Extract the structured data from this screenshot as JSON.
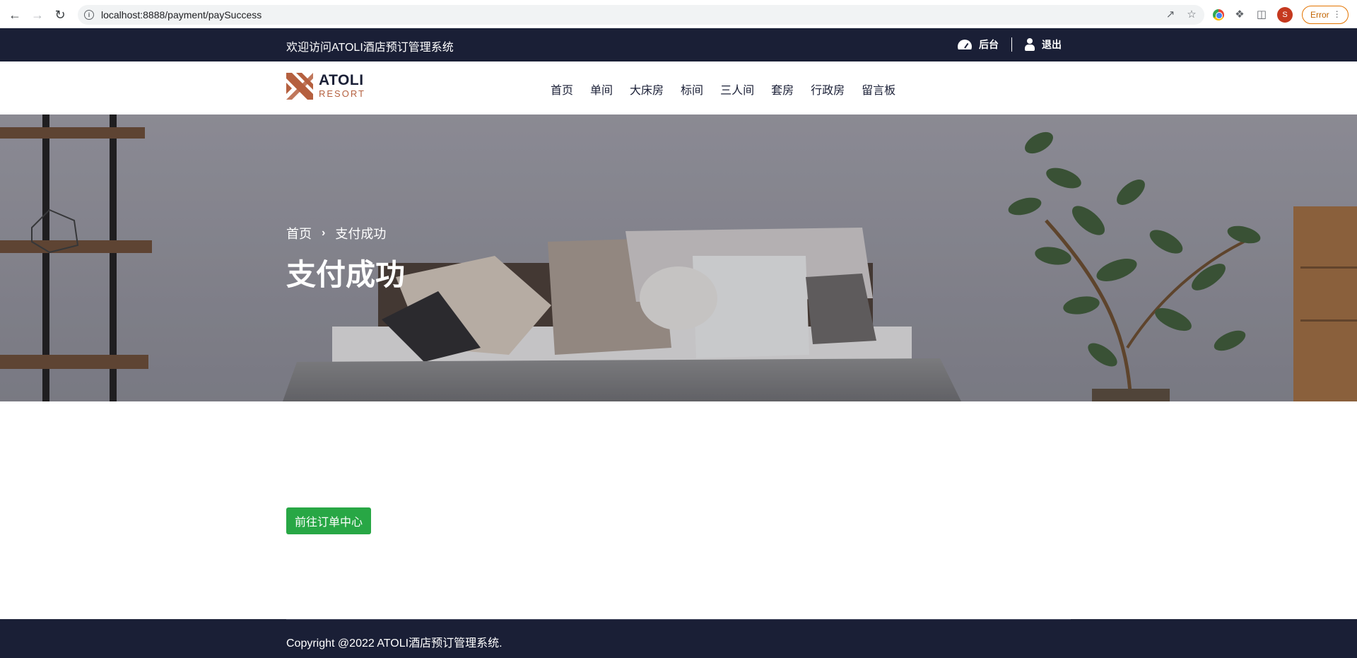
{
  "browser": {
    "url": "localhost:8888/payment/paySuccess",
    "avatar_letter": "S",
    "error_label": "Error"
  },
  "topbar": {
    "welcome": "欢迎访问ATOLI酒店预订管理系统",
    "admin_label": "后台",
    "logout_label": "退出"
  },
  "header": {
    "logo_title": "ATOLI",
    "logo_sub": "RESORT",
    "menu": [
      "首页",
      "单间",
      "大床房",
      "标间",
      "三人间",
      "套房",
      "行政房",
      "留言板"
    ]
  },
  "hero": {
    "breadcrumb_home": "首页",
    "breadcrumb_current": "支付成功",
    "title": "支付成功"
  },
  "main": {
    "orders_button": "前往订单中心"
  },
  "footer": {
    "copyright": "Copyright @2022 ATOLI酒店预订管理系统."
  },
  "colors": {
    "dark_navy": "#1a1f36",
    "brand_copper": "#b5603f",
    "success_green": "#28a745"
  }
}
